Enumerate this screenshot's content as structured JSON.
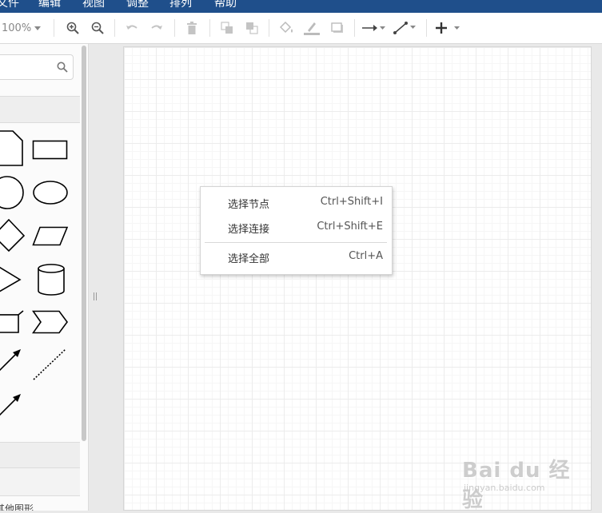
{
  "menubar": {
    "items": [
      "文件",
      "编辑",
      "视图",
      "调整",
      "排列",
      "帮助"
    ]
  },
  "toolbar": {
    "zoom": "100%",
    "icons": [
      "zoom-in-icon",
      "zoom-out-icon",
      "undo-icon",
      "redo-icon",
      "delete-icon",
      "to-front-icon",
      "to-back-icon",
      "fill-color-icon",
      "line-color-icon",
      "shadow-icon",
      "connection-icon",
      "waypoints-icon",
      "insert-icon"
    ]
  },
  "sidebar": {
    "search_placeholder": "",
    "section_label": "其他图形"
  },
  "context_menu": {
    "items": [
      {
        "label": "选择节点",
        "shortcut": "Ctrl+Shift+I"
      },
      {
        "label": "选择连接",
        "shortcut": "Ctrl+Shift+E"
      },
      {
        "label": "选择全部",
        "shortcut": "Ctrl+A"
      }
    ]
  },
  "watermark": {
    "brand": "Bai du 经验",
    "url": "jingyan.baidu.com"
  },
  "colors": {
    "header_bg": "#1f4f8b",
    "canvas_bg": "#ffffff",
    "grid": "#ececec"
  }
}
